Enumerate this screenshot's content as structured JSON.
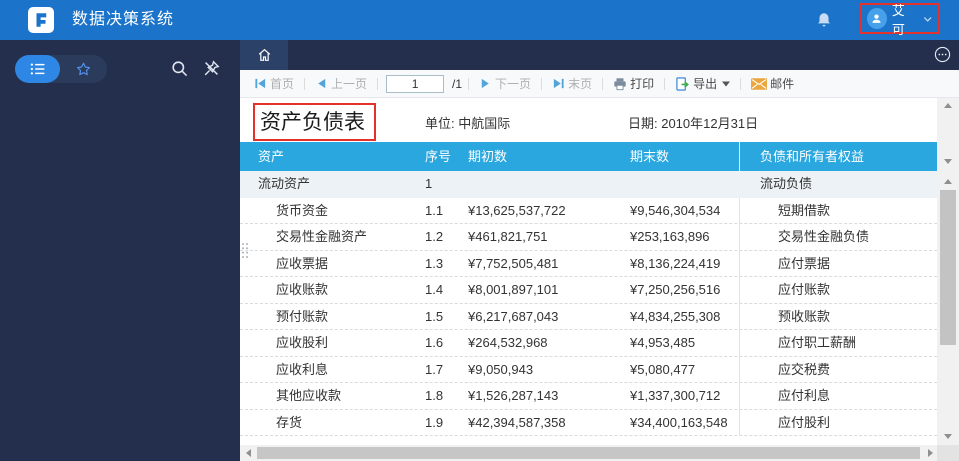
{
  "topbar": {
    "app_title": "数据决策系统",
    "user_name": "艾可"
  },
  "toolbar": {
    "first_label": "首页",
    "prev_label": "上一页",
    "page_value": "1",
    "page_total_label": "/1",
    "next_label": "下一页",
    "last_label": "末页",
    "print_label": "打印",
    "export_label": "导出",
    "mail_label": "邮件"
  },
  "report": {
    "title": "资产负债表",
    "unit_label": "单位: 中航国际",
    "date_label": "日期: 2010年12月31日",
    "table": {
      "headers": {
        "asset": "资产",
        "no": "序号",
        "begin": "期初数",
        "end": "期末数",
        "liability": "负债和所有者权益"
      },
      "rows": [
        {
          "asset": "流动资产",
          "no": "1",
          "begin": "",
          "end": "",
          "liability": "流动负债",
          "section": true
        },
        {
          "asset": "货币资金",
          "no": "1.1",
          "begin": "¥13,625,537,722",
          "end": "¥9,546,304,534",
          "liability": "短期借款"
        },
        {
          "asset": "交易性金融资产",
          "no": "1.2",
          "begin": "¥461,821,751",
          "end": "¥253,163,896",
          "liability": "交易性金融负债"
        },
        {
          "asset": "应收票据",
          "no": "1.3",
          "begin": "¥7,752,505,481",
          "end": "¥8,136,224,419",
          "liability": "应付票据"
        },
        {
          "asset": "应收账款",
          "no": "1.4",
          "begin": "¥8,001,897,101",
          "end": "¥7,250,256,516",
          "liability": "应付账款"
        },
        {
          "asset": "预付账款",
          "no": "1.5",
          "begin": "¥6,217,687,043",
          "end": "¥4,834,255,308",
          "liability": "预收账款"
        },
        {
          "asset": "应收股利",
          "no": "1.6",
          "begin": "¥264,532,968",
          "end": "¥4,953,485",
          "liability": "应付职工薪酬"
        },
        {
          "asset": "应收利息",
          "no": "1.7",
          "begin": "¥9,050,943",
          "end": "¥5,080,477",
          "liability": "应交税费"
        },
        {
          "asset": "其他应收款",
          "no": "1.8",
          "begin": "¥1,526,287,143",
          "end": "¥1,337,300,712",
          "liability": "应付利息"
        },
        {
          "asset": "存货",
          "no": "1.9",
          "begin": "¥42,394,587,358",
          "end": "¥34,400,163,548",
          "liability": "应付股利"
        }
      ]
    }
  },
  "icons": {
    "logo": "finereport-F",
    "bell": "bell",
    "avatar": "user-silhouette",
    "chevron": "chevron-down",
    "menu": "bulleted-list",
    "favorite": "star-outline",
    "search": "magnifier",
    "unpin": "pin-with-slash",
    "home": "house",
    "more": "ellipsis-in-circle",
    "first": "bar+left-triangle",
    "prev": "left-triangle",
    "next": "right-triangle",
    "last": "right-triangle+bar",
    "print": "printer",
    "export": "page-with-green-arrow",
    "mail": "orange-envelope",
    "caret": "small-triangle-down"
  },
  "colors": {
    "topbar_blue": "#1B74C9",
    "sidebar_navy": "#232F4C",
    "active_tab": "#2B4168",
    "pill_blue": "#2E87E4",
    "table_header_blue": "#2BA7DF",
    "section_row_bg": "#EDF2F6",
    "annotation_red": "#E3312B",
    "export_green": "#3FAE49",
    "mail_orange": "#EAA63F"
  }
}
